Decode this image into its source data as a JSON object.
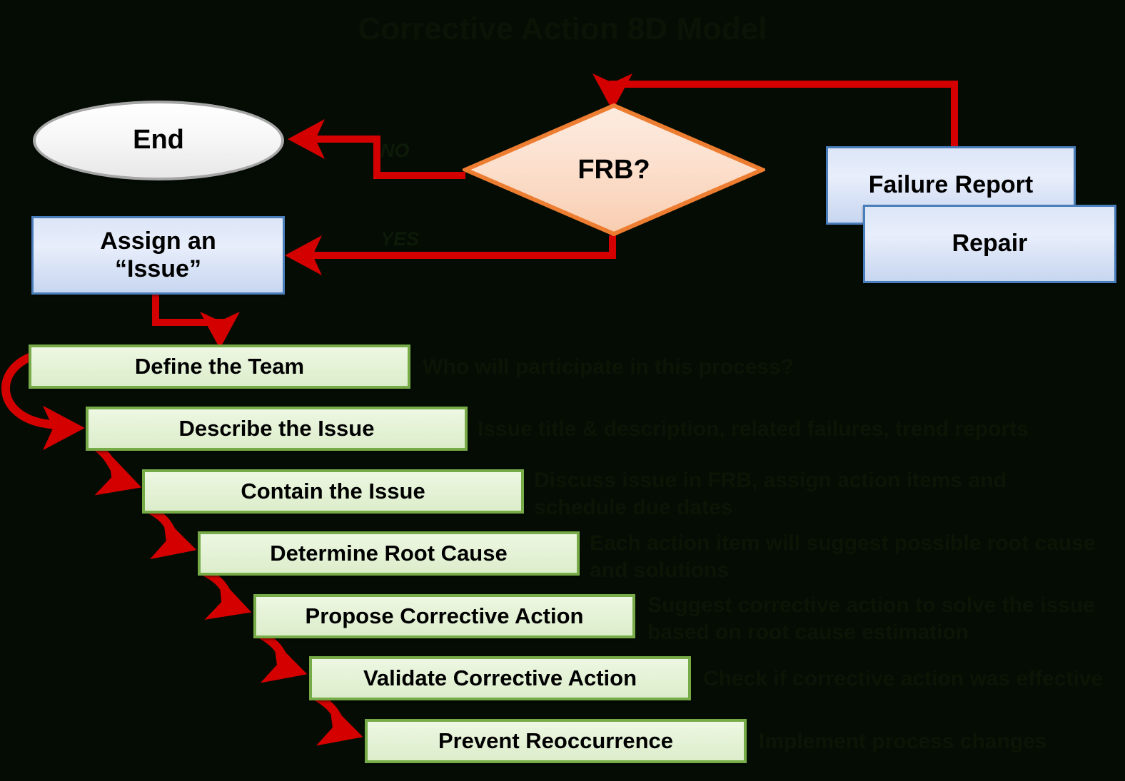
{
  "title": "Corrective Action 8D Model",
  "background_color": "#040c04",
  "colors": {
    "arrow": "#d40000",
    "green_border": "#76ab48",
    "blue_border": "#4a7ebb",
    "diamond_border": "#ed7d31",
    "terminator_border": "#a6a6a6"
  },
  "nodes": {
    "end": {
      "label": "End",
      "shape": "ellipse"
    },
    "decision": {
      "label": "FRB?",
      "shape": "diamond"
    },
    "failure_report": {
      "label": "Failure Report",
      "shape": "rectangle"
    },
    "repair": {
      "label": "Repair",
      "shape": "rectangle"
    },
    "assign_issue": {
      "label_line1": "Assign an",
      "label_line2": "“Issue”",
      "shape": "rectangle"
    }
  },
  "branch_labels": {
    "no": "NO",
    "yes": "YES"
  },
  "steps": [
    {
      "label": "Define the Team",
      "annotation": "Who will participate in this process?"
    },
    {
      "label": "Describe the Issue",
      "annotation": "Issue title & description, related failures, trend reports"
    },
    {
      "label": "Contain the Issue",
      "annotation": "Discuss issue in FRB, assign action items and schedule due dates"
    },
    {
      "label": "Determine Root Cause",
      "annotation": "Each action item will suggest possible root cause and solutions"
    },
    {
      "label": "Propose Corrective Action",
      "annotation": "Suggest corrective action to solve the issue based on root cause estimation"
    },
    {
      "label": "Validate Corrective Action",
      "annotation": "Check if corrective action was effective"
    },
    {
      "label": "Prevent Reoccurrence",
      "annotation": "Implement process changes"
    }
  ]
}
